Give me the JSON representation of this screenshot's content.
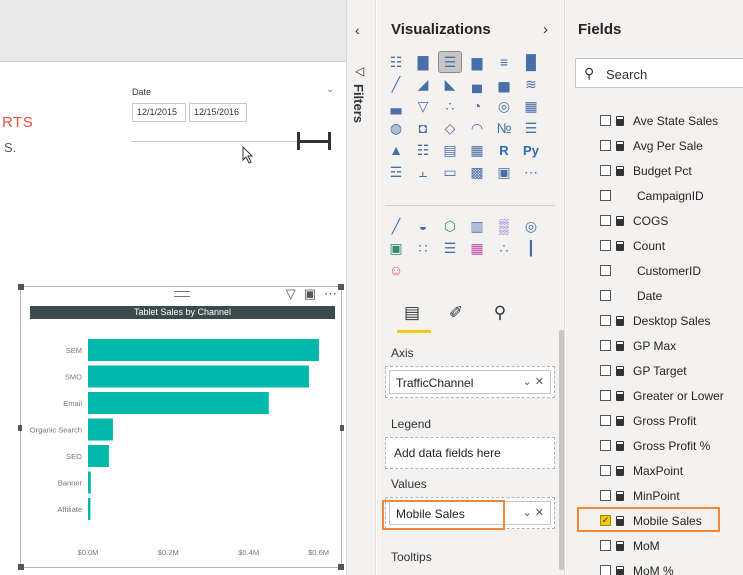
{
  "canvas": {
    "title_fragment": "RTS",
    "subtitle_fragment": "S.",
    "slicer": {
      "label": "Date",
      "start": "12/1/2015",
      "end": "12/15/2016",
      "range_fraction": [
        0.84,
        1.0
      ]
    },
    "visual": {
      "tools": [
        "filter-icon",
        "focus-mode-icon",
        "more-options-icon"
      ]
    }
  },
  "chart_data": {
    "type": "bar",
    "title": "Tablet Sales by Channel",
    "categories": [
      "SEM",
      "SMO",
      "Email",
      "Organic Search",
      "SEO",
      "Banner",
      "Affiliate"
    ],
    "values": [
      0.575,
      0.55,
      0.45,
      0.062,
      0.052,
      0.007,
      0.006
    ],
    "ticks": [
      "$0.0M",
      "$0.2M",
      "$0.4M",
      "$0.6M"
    ],
    "xlim": [
      0,
      0.6
    ],
    "color": "#01b8aa",
    "orientation": "horizontal"
  },
  "filters": {
    "label": "Filters"
  },
  "visualizations": {
    "title": "Visualizations",
    "build_icons": [
      "stacked-bar-icon",
      "stacked-column-icon",
      "clustered-bar-icon",
      "clustered-column-icon",
      "100pct-bar-icon",
      "100pct-column-icon",
      "line-chart-icon",
      "area-chart-icon",
      "stacked-area-icon",
      "line-column-icon",
      "line-clustered-column-icon",
      "ribbon-chart-icon",
      "waterfall-icon",
      "funnel-icon",
      "scatter-icon",
      "pie-chart-icon",
      "donut-chart-icon",
      "treemap-icon",
      "map-icon",
      "filled-map-icon",
      "shape-map-icon",
      "gauge-icon",
      "card-icon",
      "multirow-card-icon",
      "kpi-icon",
      "slicer-icon",
      "table-icon",
      "matrix-icon",
      "r-visual-icon",
      "python-visual-icon",
      "key-influencers-icon",
      "decomposition-tree-icon",
      "qa-icon",
      "smart-narrative-icon",
      "paginated-icon",
      "more-visuals-icon"
    ],
    "custom_icons": [
      "custom-line-icon",
      "custom-gauge-icon",
      "custom-hexagon-icon",
      "custom-table-icon",
      "custom-heatmap-icon",
      "custom-globe-icon",
      "custom-image-icon",
      "custom-dots-icon",
      "custom-list-icon",
      "custom-grid-icon",
      "custom-timeline-icon",
      "custom-barcode-icon",
      "custom-figure-icon"
    ],
    "tabs": [
      "fields-tab-icon",
      "format-tab-icon",
      "analytics-tab-icon"
    ],
    "wells": {
      "axis_label": "Axis",
      "axis_value": "TrafficChannel",
      "legend_label": "Legend",
      "legend_placeholder": "Add data fields here",
      "values_label": "Values",
      "values_value": "Mobile Sales",
      "tooltips_label": "Tooltips"
    }
  },
  "fields": {
    "title": "Fields",
    "search_placeholder": "Search",
    "items": [
      {
        "name": "Ave State Sales",
        "measure": true,
        "checked": false
      },
      {
        "name": "Avg Per Sale",
        "measure": true,
        "checked": false
      },
      {
        "name": "Budget Pct",
        "measure": true,
        "checked": false
      },
      {
        "name": "CampaignID",
        "measure": false,
        "checked": false
      },
      {
        "name": "COGS",
        "measure": true,
        "checked": false
      },
      {
        "name": "Count",
        "measure": true,
        "checked": false
      },
      {
        "name": "CustomerID",
        "measure": false,
        "checked": false
      },
      {
        "name": "Date",
        "measure": false,
        "checked": false
      },
      {
        "name": "Desktop Sales",
        "measure": true,
        "checked": false
      },
      {
        "name": "GP Max",
        "measure": true,
        "checked": false
      },
      {
        "name": "GP Target",
        "measure": true,
        "checked": false
      },
      {
        "name": "Greater or Lower",
        "measure": true,
        "checked": false
      },
      {
        "name": "Gross Profit",
        "measure": true,
        "checked": false
      },
      {
        "name": "Gross Profit %",
        "measure": true,
        "checked": false
      },
      {
        "name": "MaxPoint",
        "measure": true,
        "checked": false
      },
      {
        "name": "MinPoint",
        "measure": true,
        "checked": false
      },
      {
        "name": "Mobile Sales",
        "measure": true,
        "checked": true
      },
      {
        "name": "MoM",
        "measure": true,
        "checked": false
      },
      {
        "name": "MoM %",
        "measure": true,
        "checked": false
      }
    ],
    "highlight_color": "#f0883a"
  }
}
